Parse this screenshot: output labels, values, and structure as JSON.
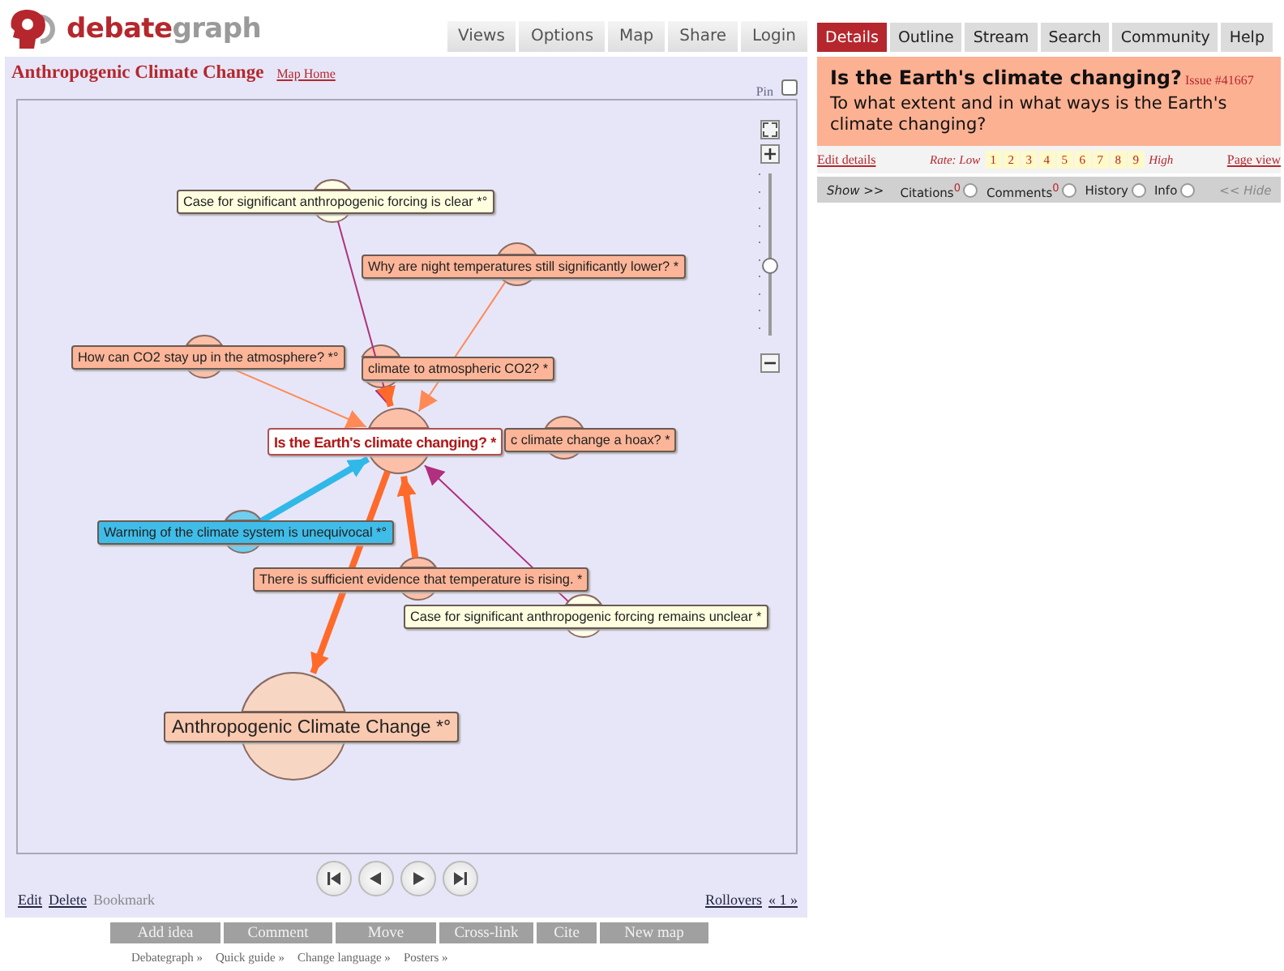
{
  "logo": {
    "first": "debate",
    "second": "graph"
  },
  "nav": [
    {
      "label": "Views"
    },
    {
      "label": "Options"
    },
    {
      "label": "Map"
    },
    {
      "label": "Share"
    },
    {
      "label": "Login"
    }
  ],
  "map_title": "Anthropogenic Climate Change",
  "map_home": "Map Home",
  "pin": {
    "label": "Pin",
    "checked": false
  },
  "map": {
    "zoom": {
      "level": 0.45
    },
    "nodes": [
      {
        "label": "Case for significant anthropogenic forcing is clear *°",
        "kind": "pro",
        "link": {
          "color": "#b0307e",
          "kind": "thin",
          "outgoing": false
        }
      },
      {
        "label": "Why are night temperatures still significantly lower? *",
        "kind": "issue",
        "link": {
          "color": "#ff8a55",
          "kind": "thin",
          "outgoing": false
        }
      },
      {
        "label": "How can CO2 stay up in the atmosphere? *°",
        "kind": "issue",
        "link": {
          "color": "#ff8a55",
          "kind": "thin",
          "outgoing": false
        }
      },
      {
        "label": "climate to atmospheric CO2? *",
        "kind": "issue",
        "link": {
          "color": "#ff6a2a",
          "kind": "thick",
          "outgoing": false
        }
      },
      {
        "label": "Is the Earth's climate changing? *",
        "kind": "focus"
      },
      {
        "label": "c climate change a hoax? *",
        "kind": "issue"
      },
      {
        "label": "Warming of the climate system is unequivocal *°",
        "kind": "position",
        "link": {
          "color": "#30b8e8",
          "kind": "thick",
          "outgoing": false
        }
      },
      {
        "label": "There is sufficient evidence that temperature is rising. *",
        "kind": "issue",
        "link": {
          "color": "#ff6a2a",
          "kind": "thick",
          "outgoing": false
        }
      },
      {
        "label": "Case for significant anthropogenic forcing remains unclear *",
        "kind": "pro",
        "link": {
          "color": "#b0307e",
          "kind": "thin",
          "outgoing": false
        }
      },
      {
        "label": "Anthropogenic Climate Change *°",
        "kind": "topic",
        "link": {
          "color": "#ff6a2a",
          "kind": "thick",
          "outgoing": true
        }
      }
    ]
  },
  "edit_links": [
    {
      "label": "Edit",
      "disabled": false
    },
    {
      "label": "Delete",
      "disabled": false
    },
    {
      "label": "Bookmark",
      "disabled": true
    }
  ],
  "rollovers": "Rollovers",
  "pager": "« 1 »",
  "actions": [
    "Add idea",
    "Comment",
    "Move",
    "Cross-link",
    "Cite",
    "New map"
  ],
  "footer": [
    "Debategraph »",
    "Quick guide »",
    "Change language »",
    "Posters »"
  ],
  "tabs": [
    {
      "label": "Details",
      "selected": true
    },
    {
      "label": "Outline",
      "selected": false
    },
    {
      "label": "Stream",
      "selected": false
    },
    {
      "label": "Search",
      "selected": false
    },
    {
      "label": "Community",
      "selected": false
    },
    {
      "label": "Help",
      "selected": false
    }
  ],
  "issue": {
    "title": "Is the Earth's climate changing?",
    "number": "Issue #41667",
    "description": "To what extent and in what ways is the Earth's climate changing?"
  },
  "edit_details": "Edit details",
  "rate": {
    "label": "Rate:",
    "low": "Low",
    "high": "High",
    "values": [
      "1",
      "2",
      "3",
      "4",
      "5",
      "6",
      "7",
      "8",
      "9"
    ]
  },
  "page_view": "Page view",
  "show": {
    "label": "Show >>",
    "options": [
      {
        "label": "Citations$^{0}$",
        "checked": false
      },
      {
        "label": "Comments$^{0}$",
        "checked": false
      },
      {
        "label": "History",
        "checked": false
      },
      {
        "label": "Info",
        "checked": false
      }
    ],
    "hide": "<< Hide"
  }
}
